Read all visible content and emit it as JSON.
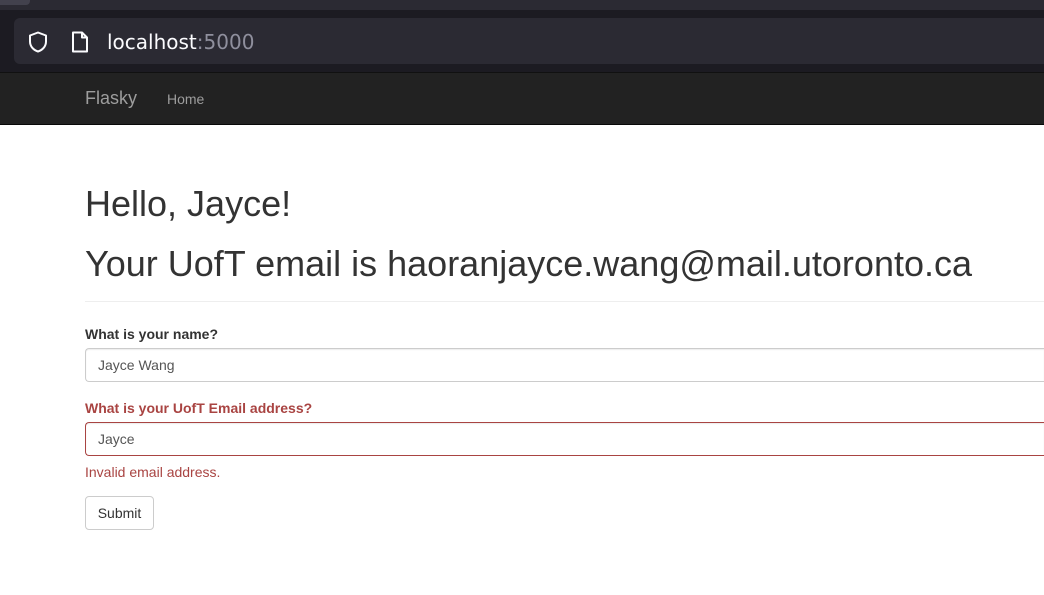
{
  "browser": {
    "url_host": "localhost",
    "url_port": ":5000",
    "icons": [
      "shield-icon",
      "page-icon"
    ]
  },
  "navbar": {
    "brand": "Flasky",
    "home": "Home"
  },
  "main": {
    "greeting": "Hello, Jayce!",
    "email_line": "Your UofT email is haoranjayce.wang@mail.utoronto.ca",
    "form": {
      "name_label": "What is your name?",
      "name_value": "Jayce Wang",
      "email_label": "What is your UofT Email address?",
      "email_value": "Jayce",
      "email_error": "Invalid email address.",
      "submit_label": "Submit"
    }
  },
  "colors": {
    "error": "#a94442",
    "navbar_bg": "#222222",
    "browser_bg": "#1c1b22"
  }
}
